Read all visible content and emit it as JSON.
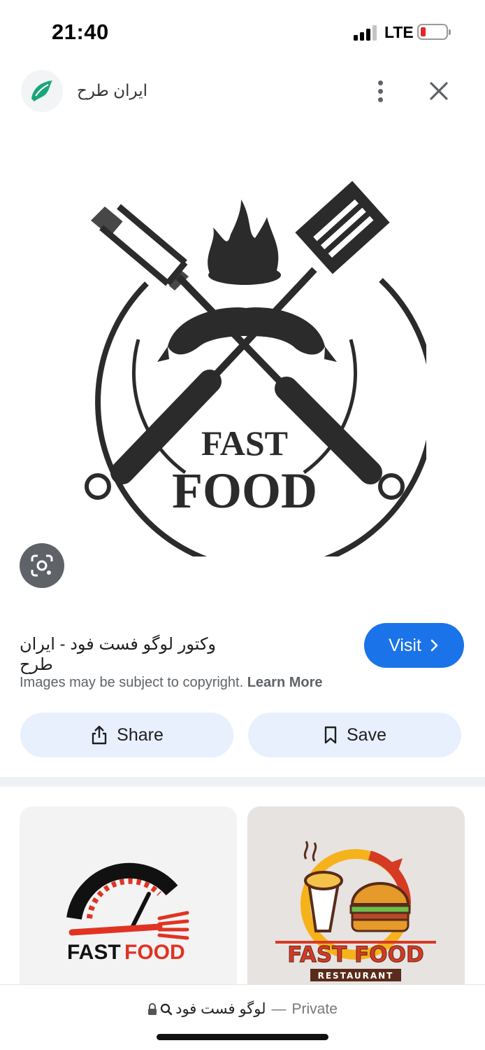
{
  "status_bar": {
    "time": "21:40",
    "network": "LTE",
    "battery_color": "#e5252a"
  },
  "header": {
    "site_name": "ایران طرح",
    "more_icon": "more-vert-icon",
    "close_icon": "close-icon"
  },
  "main_image": {
    "description_icon": "fast-food-logo",
    "text_line1": "FAST",
    "text_line2": "FOOD"
  },
  "info": {
    "title": "وکتور لوگو فست فود - ایران طرح",
    "visit_label": "Visit",
    "copyright_text": "Images may be subject to copyright.",
    "learn_more": "Learn More",
    "share_label": "Share",
    "save_label": "Save",
    "accent_color": "#1a73e8"
  },
  "related": [
    {
      "text_fast": "FAST",
      "text_food": "FOOD"
    },
    {
      "text_main": "FAST FOOD",
      "text_sub": "RESTAURANT"
    }
  ],
  "bottom_bar": {
    "query": "لوگو فست فود",
    "separator": "—",
    "mode": "Private"
  }
}
